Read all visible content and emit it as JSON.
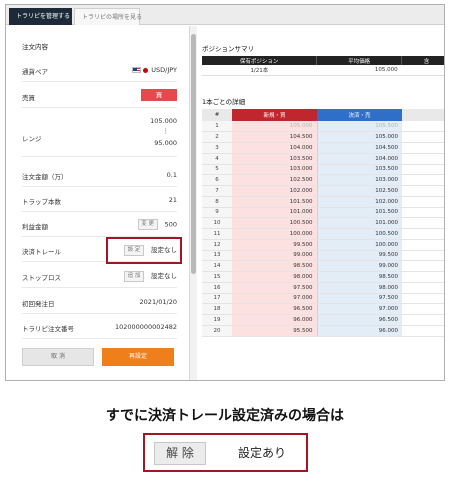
{
  "tabs": [
    "トラリピを管理する",
    "トラリピの場所を見る"
  ],
  "order": {
    "heading": "注文内容",
    "rows": [
      {
        "label": "通貨ペア",
        "value": "USD/JPY"
      },
      {
        "label": "売買",
        "value": "買"
      },
      {
        "label": "レンジ",
        "value_top": "105.000",
        "value_sep": "⋮",
        "value_bottom": "95.000"
      },
      {
        "label": "注文金額（万）",
        "value": "0.1"
      },
      {
        "label": "トラップ本数",
        "value": "21"
      },
      {
        "label": "利益金額",
        "button": "変 更",
        "value": "500"
      },
      {
        "label": "決済トレール",
        "button": "設 定",
        "value": "設定なし"
      },
      {
        "label": "ストップロス",
        "button": "追 加",
        "value": "設定なし"
      },
      {
        "label": "初回発注日",
        "value": "2021/01/20"
      },
      {
        "label": "トラリピ注文番号",
        "value": "102000000002482"
      }
    ],
    "cancel_label": "取 消",
    "reset_label": "再設定"
  },
  "summary": {
    "title": "ポジションサマリ",
    "headers": [
      "保有ポジション",
      "平均価格",
      "含"
    ],
    "row": [
      "1/21本",
      "105.000",
      ""
    ]
  },
  "detail": {
    "title": "1本ごとの詳細",
    "headers": [
      "#",
      "新規・買",
      "決済・売"
    ],
    "rows": [
      [
        "1",
        "105.000",
        "105.500"
      ],
      [
        "2",
        "104.500",
        "105.000"
      ],
      [
        "3",
        "104.000",
        "104.500"
      ],
      [
        "4",
        "103.500",
        "104.000"
      ],
      [
        "5",
        "103.000",
        "103.500"
      ],
      [
        "6",
        "102.500",
        "103.000"
      ],
      [
        "7",
        "102.000",
        "102.500"
      ],
      [
        "8",
        "101.500",
        "102.000"
      ],
      [
        "9",
        "101.000",
        "101.500"
      ],
      [
        "10",
        "100.500",
        "101.000"
      ],
      [
        "11",
        "100.000",
        "100.500"
      ],
      [
        "12",
        "99.500",
        "100.000"
      ],
      [
        "13",
        "99.000",
        "99.500"
      ],
      [
        "14",
        "98.500",
        "99.000"
      ],
      [
        "15",
        "98.000",
        "98.500"
      ],
      [
        "16",
        "97.500",
        "98.000"
      ],
      [
        "17",
        "97.000",
        "97.500"
      ],
      [
        "18",
        "96.500",
        "97.000"
      ],
      [
        "19",
        "96.000",
        "96.500"
      ],
      [
        "20",
        "95.500",
        "96.000"
      ]
    ]
  },
  "caption": "すでに決済トレール設定済みの場合は",
  "example": {
    "button": "解 除",
    "text": "設定あり"
  },
  "colors": {
    "accent_red": "#a31621",
    "sell_red": "#e5484d",
    "reset_orange": "#ef7f1a",
    "buy_header": "#c0262d",
    "sell_header": "#2f6fc9"
  }
}
